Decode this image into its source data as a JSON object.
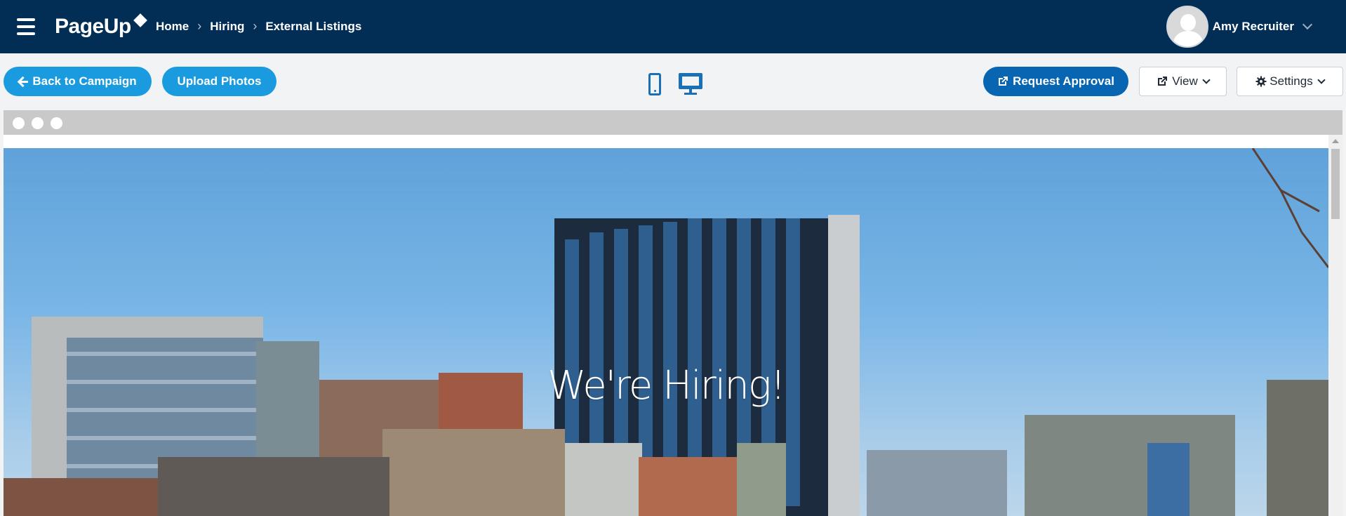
{
  "nav": {
    "logo": "PageUp",
    "breadcrumb": [
      "Home",
      "Hiring",
      "External Listings"
    ],
    "user_name": "Amy Recruiter"
  },
  "toolbar": {
    "back_label": "Back to Campaign",
    "upload_label": "Upload Photos",
    "request_approval_label": "Request Approval",
    "view_label": "View",
    "settings_label": "Settings"
  },
  "preview": {
    "hero_title": "We're Hiring!"
  },
  "icons": {
    "menu": "hamburger-icon",
    "mobile": "mobile-phone-icon",
    "desktop": "desktop-monitor-icon",
    "external": "external-link-icon",
    "settings": "gear-icon"
  },
  "colors": {
    "nav_bg": "#022e55",
    "primary_pill": "#1a9be0",
    "approval": "#0765b2",
    "device_icon": "#1a6fb7"
  }
}
